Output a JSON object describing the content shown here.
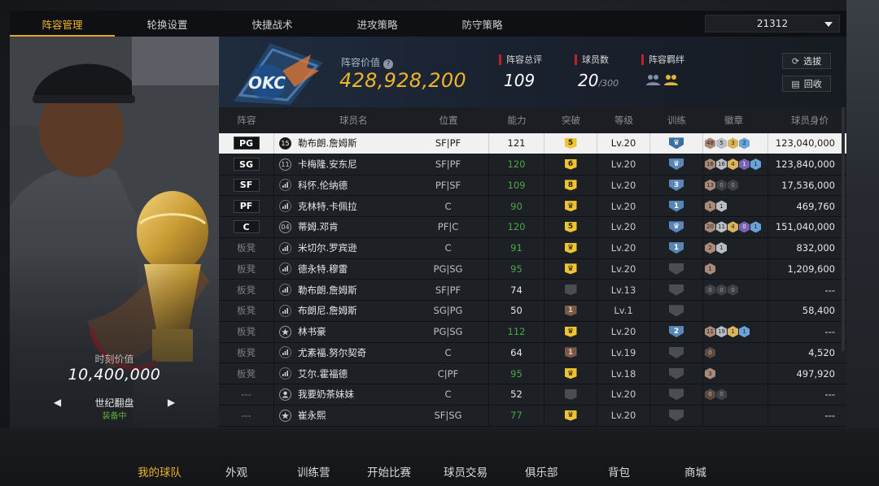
{
  "top_tabs": [
    {
      "label": "阵容管理",
      "active": true
    },
    {
      "label": "轮换设置",
      "active": false
    },
    {
      "label": "快捷战术",
      "active": false
    },
    {
      "label": "进攻策略",
      "active": false
    },
    {
      "label": "防守策略",
      "active": false
    }
  ],
  "lineup_select": {
    "value": "21312"
  },
  "player_card": {
    "value_label": "时刻价值",
    "value": "10,400,000",
    "item_name": "世纪翻盘",
    "item_status": "装备中",
    "prev_arrow": "◀",
    "next_arrow": "▶"
  },
  "summary": {
    "team_logo_text": "OKC",
    "value_label": "阵容价值",
    "value_amount": "428,928,200",
    "overall_label": "阵容总评",
    "overall_value": "109",
    "count_label": "球员数",
    "count_value": "20",
    "count_max": "/300",
    "bond_label": "阵容羁绊",
    "select_button": "选拔",
    "recycle_button": "回收"
  },
  "table": {
    "headers": {
      "pos": "阵容",
      "name": "球员名",
      "position": "位置",
      "rating": "能力",
      "break": "突破",
      "level": "等级",
      "train": "训练",
      "badges": "徽章",
      "price": "球员身价"
    },
    "rows": [
      {
        "slot": "PG",
        "starter": true,
        "icon": "jersey",
        "icon_text": "15",
        "name": "勒布朗.詹姆斯",
        "position": "SF|PF",
        "rating": "121",
        "rating_green": false,
        "break": "5",
        "break_style": "gold",
        "level": "Lv.20",
        "train": "crown",
        "train_style": "blue",
        "badges": [
          {
            "t": "48",
            "s": "bronze"
          },
          {
            "t": "5",
            "s": "silver"
          },
          {
            "t": "3",
            "s": "gold"
          },
          {
            "t": "2",
            "s": "blue"
          }
        ],
        "price": "123,040,000",
        "selected": true
      },
      {
        "slot": "SG",
        "starter": true,
        "icon": "jersey",
        "icon_text": "11",
        "name": "卡梅隆.安东尼",
        "position": "SF|PF",
        "rating": "120",
        "rating_green": true,
        "break": "6",
        "break_style": "gold",
        "level": "Lv.20",
        "train": "crown",
        "train_style": "blue",
        "badges": [
          {
            "t": "16",
            "s": "bronze"
          },
          {
            "t": "16",
            "s": "silver"
          },
          {
            "t": "4",
            "s": "gold"
          },
          {
            "t": "1",
            "s": "purple"
          },
          {
            "t": "1",
            "s": "blue"
          }
        ],
        "price": "123,840,000",
        "selected": false
      },
      {
        "slot": "SF",
        "starter": true,
        "icon": "bars",
        "icon_text": "",
        "name": "科怀.伦纳德",
        "position": "PF|SF",
        "rating": "109",
        "rating_green": true,
        "break": "8",
        "break_style": "gold",
        "level": "Lv.20",
        "train": "3",
        "train_style": "blue",
        "badges": [
          {
            "t": "13",
            "s": "bronze"
          },
          {
            "t": "0",
            "s": "dgrey"
          },
          {
            "t": "0",
            "s": "dgrey"
          }
        ],
        "price": "17,536,000",
        "selected": false
      },
      {
        "slot": "PF",
        "starter": true,
        "icon": "bars",
        "icon_text": "",
        "name": "克林特.卡佩拉",
        "position": "C",
        "rating": "90",
        "rating_green": true,
        "break": "crown",
        "break_style": "gold",
        "level": "Lv.20",
        "train": "1",
        "train_style": "blue",
        "badges": [
          {
            "t": "1",
            "s": "bronze"
          },
          {
            "t": "1",
            "s": "silver"
          }
        ],
        "price": "469,760",
        "selected": false
      },
      {
        "slot": "C",
        "starter": true,
        "icon": "jersey",
        "icon_text": "04",
        "name": "蒂姆.邓肯",
        "position": "PF|C",
        "rating": "120",
        "rating_green": true,
        "break": "5",
        "break_style": "gold",
        "level": "Lv.20",
        "train": "crown",
        "train_style": "blue",
        "badges": [
          {
            "t": "20",
            "s": "bronze"
          },
          {
            "t": "11",
            "s": "silver"
          },
          {
            "t": "4",
            "s": "gold"
          },
          {
            "t": "0",
            "s": "purple"
          },
          {
            "t": "1",
            "s": "blue"
          }
        ],
        "price": "151,040,000",
        "selected": false
      },
      {
        "slot": "板凳",
        "starter": false,
        "icon": "bars",
        "icon_text": "",
        "name": "米切尔.罗宾逊",
        "position": "C",
        "rating": "91",
        "rating_green": true,
        "break": "crown",
        "break_style": "gold",
        "level": "Lv.20",
        "train": "1",
        "train_style": "blue",
        "badges": [
          {
            "t": "2",
            "s": "bronze"
          },
          {
            "t": "1",
            "s": "silver"
          }
        ],
        "price": "832,000",
        "selected": false
      },
      {
        "slot": "板凳",
        "starter": false,
        "icon": "bars",
        "icon_text": "",
        "name": "德永特.穆雷",
        "position": "PG|SG",
        "rating": "95",
        "rating_green": true,
        "break": "crown",
        "break_style": "gold",
        "level": "Lv.20",
        "train": "",
        "train_style": "grey",
        "badges": [
          {
            "t": "1",
            "s": "bronze"
          }
        ],
        "price": "1,209,600",
        "selected": false
      },
      {
        "slot": "板凳",
        "starter": false,
        "icon": "bars",
        "icon_text": "",
        "name": "勒布朗.詹姆斯",
        "position": "SF|PF",
        "rating": "74",
        "rating_green": false,
        "break": "",
        "break_style": "grey",
        "level": "Lv.13",
        "train": "",
        "train_style": "grey",
        "badges": [
          {
            "t": "0",
            "s": "dgrey"
          },
          {
            "t": "0",
            "s": "dgrey"
          },
          {
            "t": "0",
            "s": "dgrey"
          }
        ],
        "price": "---",
        "selected": false
      },
      {
        "slot": "板凳",
        "starter": false,
        "icon": "bars",
        "icon_text": "",
        "name": "布朗尼.詹姆斯",
        "position": "SG|PG",
        "rating": "50",
        "rating_green": false,
        "break": "1",
        "break_style": "brown",
        "level": "Lv.1",
        "train": "",
        "train_style": "grey",
        "badges": [],
        "price": "58,400",
        "selected": false
      },
      {
        "slot": "板凳",
        "starter": false,
        "icon": "star",
        "icon_text": "",
        "name": "林书豪",
        "position": "PG|SG",
        "rating": "112",
        "rating_green": true,
        "break": "crown",
        "break_style": "gold",
        "level": "Lv.20",
        "train": "2",
        "train_style": "blue",
        "badges": [
          {
            "t": "11",
            "s": "bronze"
          },
          {
            "t": "19",
            "s": "silver"
          },
          {
            "t": "1",
            "s": "gold"
          },
          {
            "t": "1",
            "s": "blue"
          }
        ],
        "price": "---",
        "selected": false
      },
      {
        "slot": "板凳",
        "starter": false,
        "icon": "bars",
        "icon_text": "",
        "name": "尤素福.努尔契奇",
        "position": "C",
        "rating": "64",
        "rating_green": false,
        "break": "1",
        "break_style": "brown",
        "level": "Lv.19",
        "train": "",
        "train_style": "grey",
        "badges": [
          {
            "t": "0",
            "s": "dark"
          }
        ],
        "price": "4,520",
        "selected": false
      },
      {
        "slot": "板凳",
        "starter": false,
        "icon": "bars",
        "icon_text": "",
        "name": "艾尔.霍福德",
        "position": "C|PF",
        "rating": "95",
        "rating_green": true,
        "break": "crown",
        "break_style": "gold",
        "level": "Lv.18",
        "train": "",
        "train_style": "grey",
        "badges": [
          {
            "t": "3",
            "s": "bronze"
          }
        ],
        "price": "497,920",
        "selected": false
      },
      {
        "slot": "---",
        "starter": false,
        "icon": "person",
        "icon_text": "",
        "name": "我要奶茶妹妹",
        "position": "C",
        "rating": "52",
        "rating_green": false,
        "break": "",
        "break_style": "grey",
        "level": "Lv.20",
        "train": "",
        "train_style": "grey",
        "badges": [
          {
            "t": "0",
            "s": "dark"
          },
          {
            "t": "0",
            "s": "dgrey"
          }
        ],
        "price": "---",
        "selected": false
      },
      {
        "slot": "---",
        "starter": false,
        "icon": "star",
        "icon_text": "",
        "name": "崔永熙",
        "position": "SF|SG",
        "rating": "77",
        "rating_green": true,
        "break": "crown",
        "break_style": "gold",
        "level": "Lv.20",
        "train": "",
        "train_style": "grey",
        "badges": [],
        "price": "---",
        "selected": false
      }
    ]
  },
  "bottom_nav": [
    {
      "label": "我的球队",
      "active": true
    },
    {
      "label": "外观",
      "active": false
    },
    {
      "label": "训练营",
      "active": false
    },
    {
      "label": "开始比赛",
      "active": false
    },
    {
      "label": "球员交易",
      "active": false
    },
    {
      "label": "俱乐部",
      "active": false
    },
    {
      "label": "背包",
      "active": false
    },
    {
      "label": "商城",
      "active": false
    }
  ]
}
